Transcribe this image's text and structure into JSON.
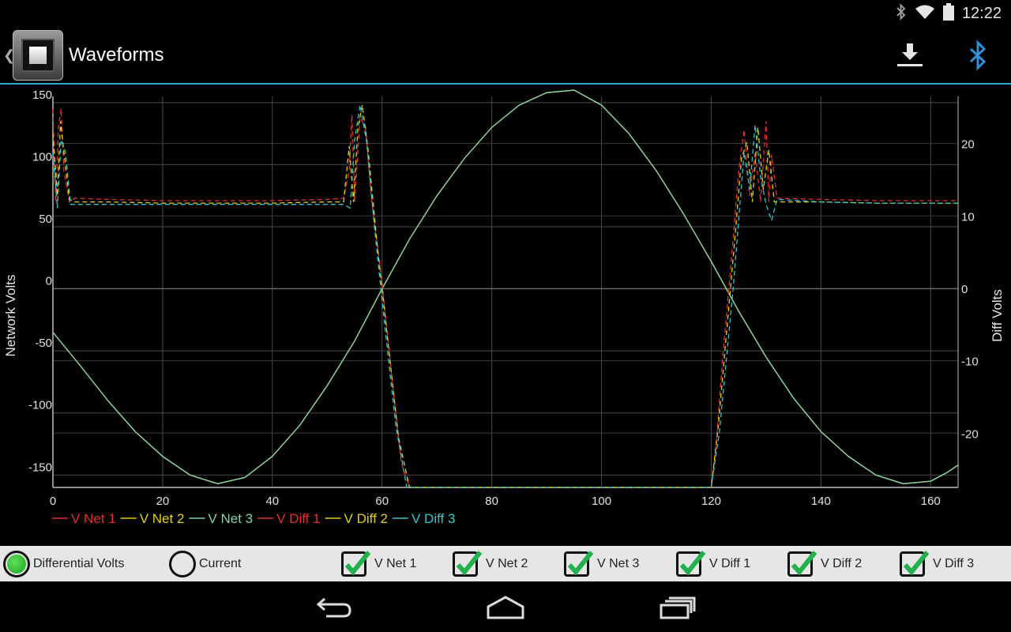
{
  "status_bar": {
    "time": "12:22"
  },
  "app": {
    "title": "Waveforms"
  },
  "icons": {
    "bluetooth_status": "bluetooth-icon",
    "wifi": "wifi-icon",
    "battery": "battery-icon",
    "download": "download-icon",
    "bluetooth_action": "bluetooth-icon"
  },
  "colors": {
    "accent": "#33a3d6",
    "v_net_1": "#e03030",
    "v_net_2": "#e0d020",
    "v_net_3": "#30c8c8",
    "current_trace": "#7fd6a8"
  },
  "controls": {
    "radio_differential": {
      "label": "Differential Volts",
      "selected": true
    },
    "radio_current": {
      "label": "Current",
      "selected": false
    },
    "checks": [
      {
        "label": "V Net 1",
        "checked": true
      },
      {
        "label": "V Net 2",
        "checked": true
      },
      {
        "label": "V Net 3",
        "checked": true
      },
      {
        "label": "V Diff 1",
        "checked": true
      },
      {
        "label": "V Diff 2",
        "checked": true
      },
      {
        "label": "V Diff 3",
        "checked": true
      }
    ]
  },
  "chart_data": {
    "type": "line",
    "title": "",
    "xlabel": "",
    "ylabel": "Network Volts",
    "y2label": "Diff Volts",
    "xlim": [
      0,
      165
    ],
    "ylim": [
      -160,
      155
    ],
    "y2lim": [
      -27.5,
      26.5
    ],
    "x_ticks": [
      0,
      20,
      40,
      60,
      80,
      100,
      120,
      140,
      160
    ],
    "y_ticks": [
      150,
      100,
      50,
      0,
      -50,
      -100,
      -150
    ],
    "y2_ticks": [
      20,
      10,
      0,
      -10,
      -20
    ],
    "grid": true,
    "legend_position": "bottom-left",
    "legend": [
      "V Net 1",
      "V Net 2",
      "V Net 3",
      "V Diff 1",
      "V Diff 2",
      "V Diff 3"
    ],
    "series": [
      {
        "name": "V Net 1",
        "color": "#e03030",
        "style": "solid",
        "points": [
          [
            0,
            -35
          ],
          [
            5,
            -62
          ],
          [
            10,
            -90
          ],
          [
            15,
            -115
          ],
          [
            20,
            -135
          ],
          [
            25,
            -150
          ],
          [
            30,
            -157
          ],
          [
            35,
            -152
          ],
          [
            40,
            -135
          ],
          [
            45,
            -110
          ],
          [
            50,
            -78
          ],
          [
            55,
            -42
          ],
          [
            60,
            0
          ],
          [
            65,
            40
          ],
          [
            70,
            75
          ],
          [
            75,
            105
          ],
          [
            80,
            130
          ],
          [
            85,
            148
          ],
          [
            90,
            158
          ],
          [
            95,
            160
          ],
          [
            100,
            148
          ],
          [
            105,
            125
          ],
          [
            110,
            95
          ],
          [
            115,
            60
          ],
          [
            120,
            22
          ],
          [
            125,
            -18
          ],
          [
            130,
            -55
          ],
          [
            135,
            -88
          ],
          [
            140,
            -115
          ],
          [
            145,
            -135
          ],
          [
            150,
            -150
          ],
          [
            155,
            -157
          ],
          [
            160,
            -155
          ],
          [
            163,
            -148
          ],
          [
            165,
            -142
          ]
        ]
      },
      {
        "name": "V Net 2",
        "color": "#e0d020",
        "style": "solid",
        "points": [
          [
            0,
            -35
          ],
          [
            5,
            -62
          ],
          [
            10,
            -90
          ],
          [
            15,
            -115
          ],
          [
            20,
            -135
          ],
          [
            25,
            -150
          ],
          [
            30,
            -157
          ],
          [
            35,
            -152
          ],
          [
            40,
            -135
          ],
          [
            45,
            -110
          ],
          [
            50,
            -78
          ],
          [
            55,
            -42
          ],
          [
            60,
            0
          ],
          [
            65,
            40
          ],
          [
            70,
            75
          ],
          [
            75,
            105
          ],
          [
            80,
            130
          ],
          [
            85,
            148
          ],
          [
            90,
            158
          ],
          [
            95,
            160
          ],
          [
            100,
            148
          ],
          [
            105,
            125
          ],
          [
            110,
            95
          ],
          [
            115,
            60
          ],
          [
            120,
            22
          ],
          [
            125,
            -18
          ],
          [
            130,
            -55
          ],
          [
            135,
            -88
          ],
          [
            140,
            -115
          ],
          [
            145,
            -135
          ],
          [
            150,
            -150
          ],
          [
            155,
            -157
          ],
          [
            160,
            -155
          ],
          [
            163,
            -148
          ],
          [
            165,
            -142
          ]
        ]
      },
      {
        "name": "V Net 3",
        "color": "#7fd6a8",
        "style": "solid",
        "points": [
          [
            0,
            -35
          ],
          [
            5,
            -62
          ],
          [
            10,
            -90
          ],
          [
            15,
            -115
          ],
          [
            20,
            -135
          ],
          [
            25,
            -150
          ],
          [
            30,
            -157
          ],
          [
            35,
            -152
          ],
          [
            40,
            -135
          ],
          [
            45,
            -110
          ],
          [
            50,
            -78
          ],
          [
            55,
            -42
          ],
          [
            60,
            0
          ],
          [
            65,
            40
          ],
          [
            70,
            75
          ],
          [
            75,
            105
          ],
          [
            80,
            130
          ],
          [
            85,
            148
          ],
          [
            90,
            158
          ],
          [
            95,
            160
          ],
          [
            100,
            148
          ],
          [
            105,
            125
          ],
          [
            110,
            95
          ],
          [
            115,
            60
          ],
          [
            120,
            22
          ],
          [
            125,
            -18
          ],
          [
            130,
            -55
          ],
          [
            135,
            -88
          ],
          [
            140,
            -115
          ],
          [
            145,
            -135
          ],
          [
            150,
            -150
          ],
          [
            155,
            -157
          ],
          [
            160,
            -155
          ],
          [
            163,
            -148
          ],
          [
            165,
            -142
          ]
        ]
      },
      {
        "name": "V Diff 1",
        "color": "#e03030",
        "style": "dashed",
        "points": [
          [
            0,
            145
          ],
          [
            0.5,
            70
          ],
          [
            1,
            130
          ],
          [
            1.5,
            145
          ],
          [
            2,
            95
          ],
          [
            3,
            70
          ],
          [
            4,
            73
          ],
          [
            10,
            72
          ],
          [
            20,
            71
          ],
          [
            30,
            71
          ],
          [
            40,
            71
          ],
          [
            50,
            72
          ],
          [
            53,
            73
          ],
          [
            54,
            95
          ],
          [
            54.5,
            140
          ],
          [
            55,
            70
          ],
          [
            56,
            138
          ],
          [
            57,
            130
          ],
          [
            58,
            75
          ],
          [
            60,
            5
          ],
          [
            62,
            -80
          ],
          [
            63.5,
            -140
          ],
          [
            65,
            -160
          ],
          [
            100,
            -160
          ],
          [
            120,
            -160
          ],
          [
            121,
            -120
          ],
          [
            122,
            -60
          ],
          [
            123,
            -10
          ],
          [
            124,
            40
          ],
          [
            125,
            95
          ],
          [
            126,
            128
          ],
          [
            127,
            75
          ],
          [
            128,
            110
          ],
          [
            129,
            70
          ],
          [
            130,
            135
          ],
          [
            130.5,
            70
          ],
          [
            131,
            108
          ],
          [
            132,
            73
          ],
          [
            140,
            72
          ],
          [
            150,
            71
          ],
          [
            165,
            71
          ]
        ]
      },
      {
        "name": "V Diff 2",
        "color": "#e0d020",
        "style": "dashed",
        "points": [
          [
            0,
            125
          ],
          [
            0.8,
            75
          ],
          [
            1.4,
            135
          ],
          [
            2,
            110
          ],
          [
            3,
            72
          ],
          [
            4,
            70
          ],
          [
            10,
            70
          ],
          [
            20,
            69
          ],
          [
            30,
            69
          ],
          [
            40,
            69
          ],
          [
            50,
            70
          ],
          [
            53,
            70
          ],
          [
            54,
            115
          ],
          [
            54.8,
            70
          ],
          [
            55.6,
            130
          ],
          [
            56.4,
            148
          ],
          [
            57.5,
            110
          ],
          [
            59,
            40
          ],
          [
            61,
            -40
          ],
          [
            63,
            -120
          ],
          [
            65,
            -160
          ],
          [
            100,
            -160
          ],
          [
            120,
            -160
          ],
          [
            121.3,
            -110
          ],
          [
            122.5,
            -50
          ],
          [
            123.5,
            0
          ],
          [
            124.5,
            50
          ],
          [
            125.5,
            105
          ],
          [
            126.5,
            118
          ],
          [
            127.5,
            70
          ],
          [
            128.5,
            130
          ],
          [
            129.5,
            80
          ],
          [
            130.5,
            112
          ],
          [
            131.5,
            70
          ],
          [
            140,
            70
          ],
          [
            150,
            69
          ],
          [
            165,
            69
          ]
        ]
      },
      {
        "name": "V Diff 3",
        "color": "#30c8c8",
        "style": "dashed",
        "points": [
          [
            0,
            110
          ],
          [
            0.8,
            65
          ],
          [
            1.5,
            120
          ],
          [
            2.3,
            110
          ],
          [
            3.2,
            68
          ],
          [
            4,
            68
          ],
          [
            10,
            68
          ],
          [
            20,
            68
          ],
          [
            30,
            68
          ],
          [
            40,
            68
          ],
          [
            50,
            68
          ],
          [
            53,
            68
          ],
          [
            54.2,
            65
          ],
          [
            55,
            120
          ],
          [
            56,
            148
          ],
          [
            57.2,
            118
          ],
          [
            58.6,
            50
          ],
          [
            60.5,
            -30
          ],
          [
            62.5,
            -110
          ],
          [
            64.5,
            -160
          ],
          [
            100,
            -160
          ],
          [
            120,
            -160
          ],
          [
            121.5,
            -115
          ],
          [
            122.8,
            -55
          ],
          [
            124,
            0
          ],
          [
            125,
            55
          ],
          [
            126,
            110
          ],
          [
            127,
            80
          ],
          [
            128,
            132
          ],
          [
            129,
            90
          ],
          [
            130,
            68
          ],
          [
            131,
            55
          ],
          [
            132,
            72
          ],
          [
            140,
            70
          ],
          [
            150,
            69
          ],
          [
            165,
            69
          ]
        ]
      }
    ]
  }
}
